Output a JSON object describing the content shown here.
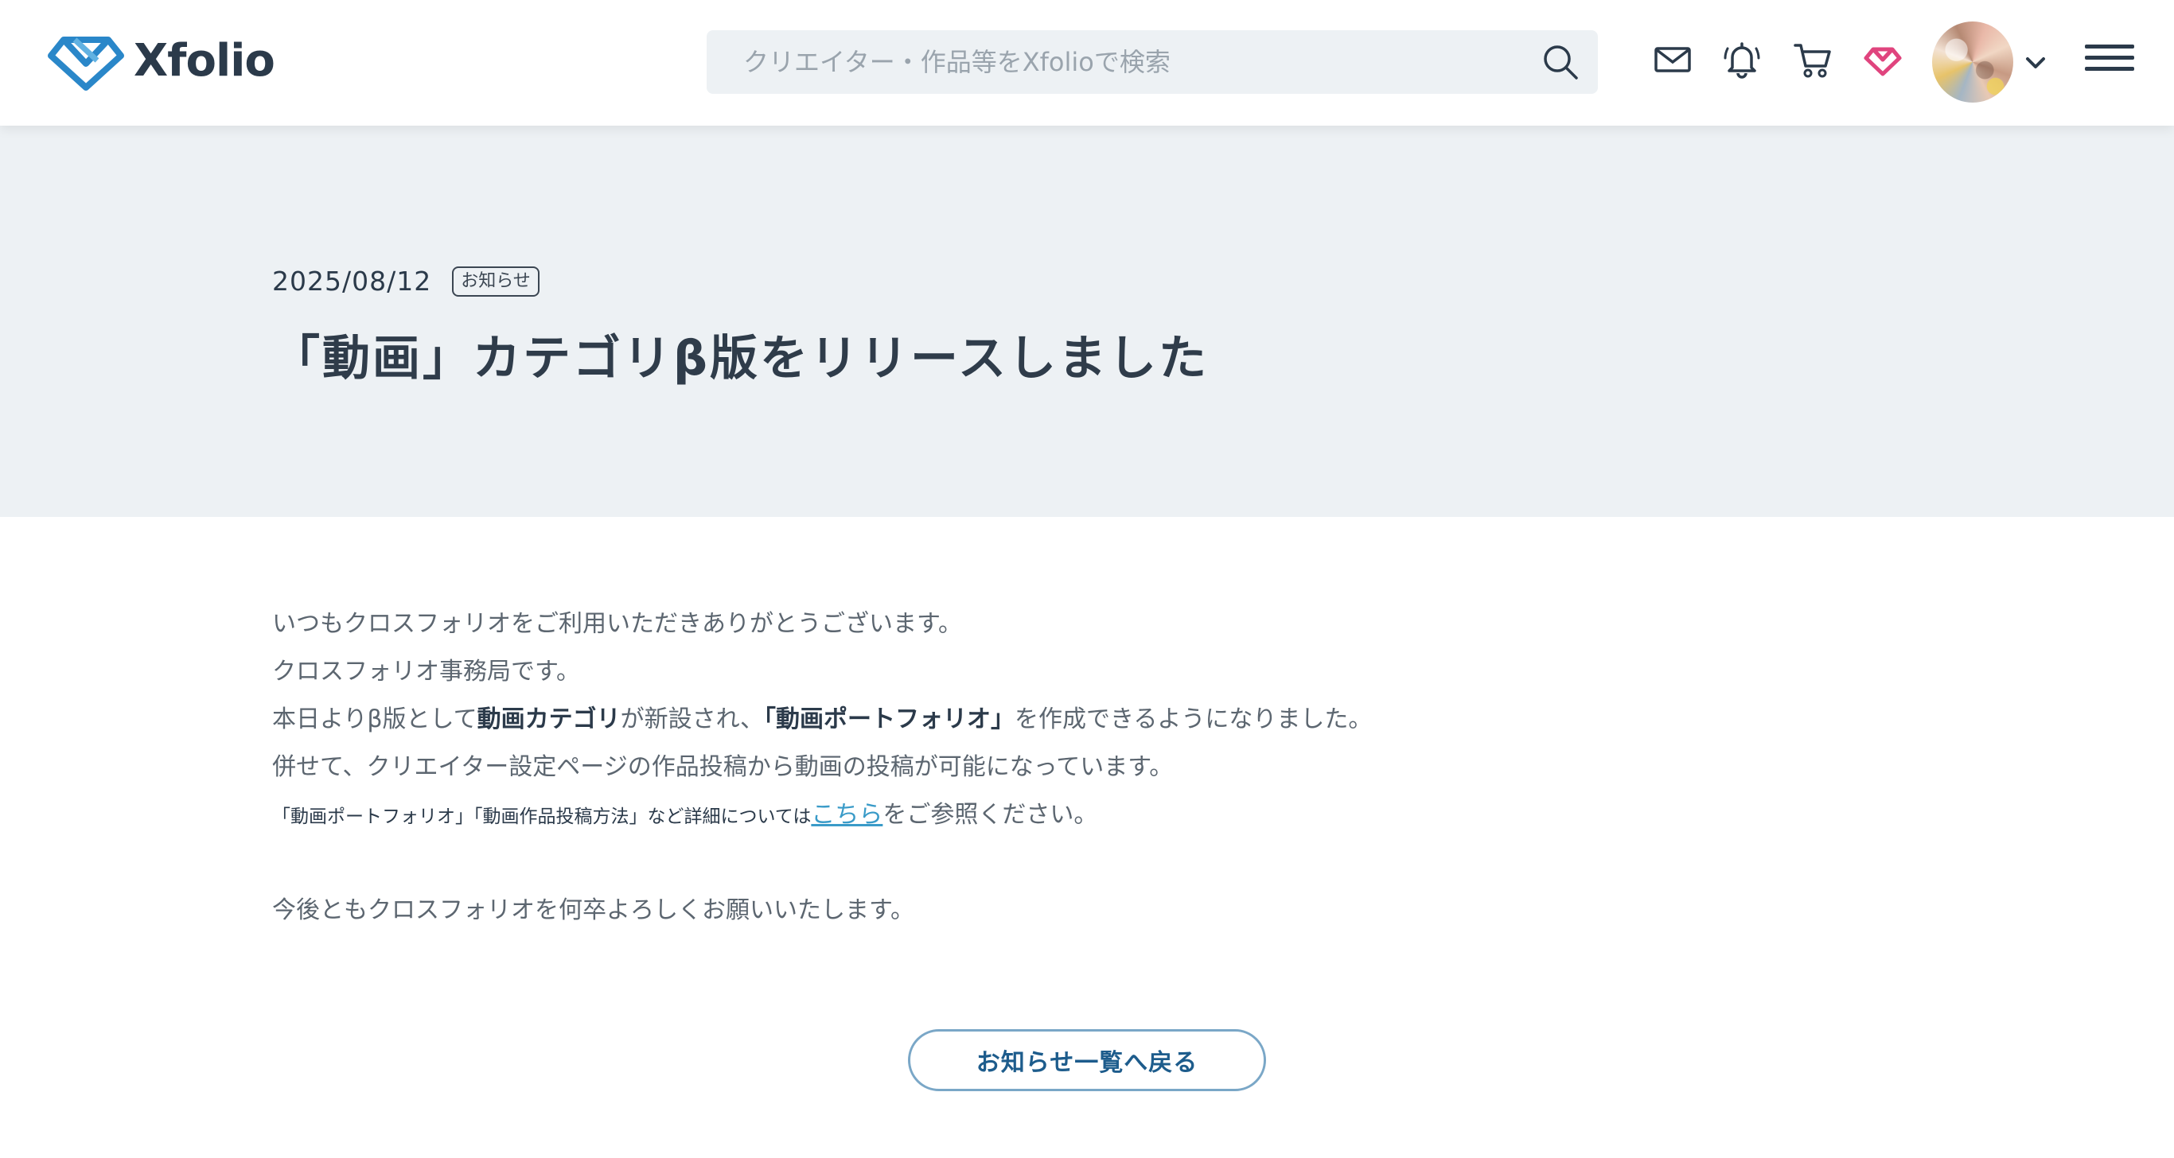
{
  "header": {
    "logo_text": "Xfolio",
    "search_placeholder": "クリエイター・作品等をXfolioで検索",
    "icons": [
      "envelope-icon",
      "bell-icon",
      "cart-icon",
      "xfolio-heart-icon",
      "avatar",
      "chevron-down-icon",
      "hamburger-menu-icon"
    ]
  },
  "article": {
    "date": "2025/08/12",
    "tag": "お知らせ",
    "title": "「動画」カテゴリβ版をリリースしました",
    "line1": "いつもクロスフォリオをご利用いただきありがとうございます。",
    "line2": "クロスフォリオ事務局です。",
    "line3_a": "本日よりβ版として",
    "line3_b": "動画カテゴリ",
    "line3_c": "が新設され、",
    "line3_d": "「動画ポートフォリオ」",
    "line3_e": "を作成できるようになりました。",
    "line4": "併せて、クリエイター設定ページの作品投稿から動画の投稿が可能になっています。",
    "line5_a": "「動画ポートフォリオ」「動画作品投稿方法」など詳細については",
    "line5_link": "こちら",
    "line5_b": "をご参照ください。",
    "line6": "今後ともクロスフォリオを何卒よろしくお願いいたします。"
  },
  "back_button": "お知らせ一覧へ戻る",
  "colors": {
    "hero_bg": "#edf1f4",
    "link": "#3a9bc8",
    "button_border": "#7aa7c7",
    "button_text": "#1d5c8c",
    "logo_blue": "#2a87c9",
    "heart_pink": "#e0447e"
  }
}
